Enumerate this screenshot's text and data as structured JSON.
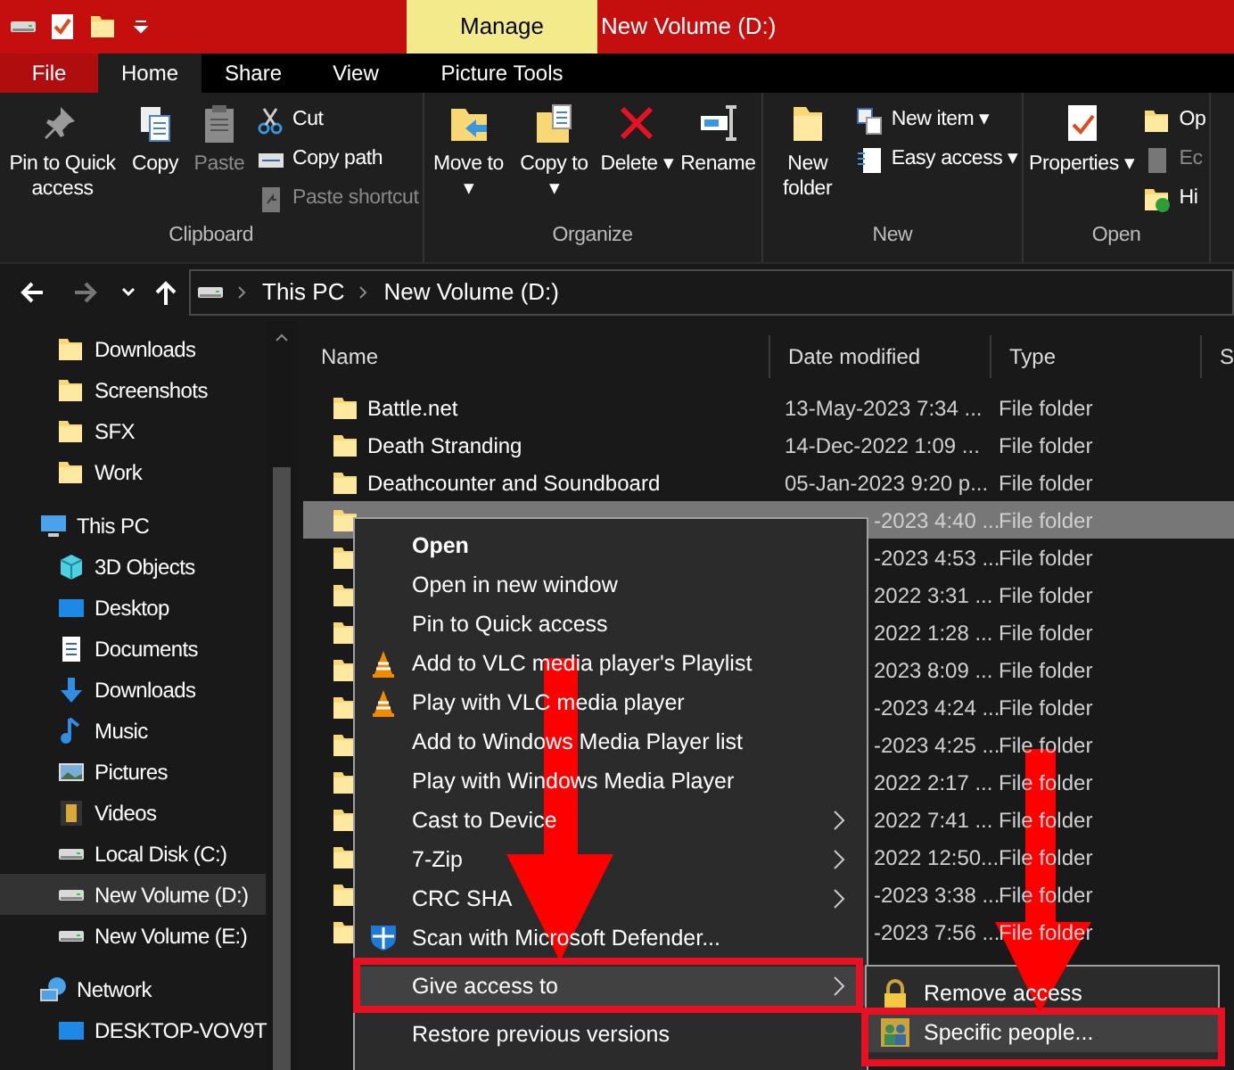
{
  "window": {
    "title": "New Volume (D:)",
    "context_tab": "Manage"
  },
  "tabs": [
    {
      "label": "File",
      "selected": false,
      "kind": "file"
    },
    {
      "label": "Home",
      "selected": true,
      "kind": "tab"
    },
    {
      "label": "Share",
      "selected": false,
      "kind": "tab"
    },
    {
      "label": "View",
      "selected": false,
      "kind": "tab"
    },
    {
      "label": "Picture Tools",
      "selected": false,
      "kind": "tab"
    }
  ],
  "ribbon": {
    "groups": [
      {
        "label": "Clipboard",
        "large": [
          {
            "label": "Pin to Quick access",
            "disabled": false
          },
          {
            "label": "Copy",
            "disabled": false
          },
          {
            "label": "Paste",
            "disabled": true
          }
        ],
        "small": [
          {
            "label": "Cut",
            "disabled": false
          },
          {
            "label": "Copy path",
            "disabled": false
          },
          {
            "label": "Paste shortcut",
            "disabled": true
          }
        ]
      },
      {
        "label": "Organize",
        "large": [
          {
            "label": "Move to ▾",
            "disabled": false
          },
          {
            "label": "Copy to ▾",
            "disabled": false
          },
          {
            "label": "Delete ▾",
            "disabled": false
          },
          {
            "label": "Rename",
            "disabled": false
          }
        ]
      },
      {
        "label": "New",
        "large": [
          {
            "label": "New folder",
            "disabled": false
          }
        ],
        "small": [
          {
            "label": "New item ▾",
            "disabled": false
          },
          {
            "label": "Easy access ▾",
            "disabled": false
          }
        ]
      },
      {
        "label": "Open",
        "large": [
          {
            "label": "Properties ▾",
            "disabled": false
          }
        ],
        "small": [
          {
            "label": "Op",
            "disabled": false
          },
          {
            "label": "Ec",
            "disabled": true
          },
          {
            "label": "Hi",
            "disabled": false
          }
        ]
      }
    ]
  },
  "address": {
    "back_disabled": false,
    "forward_disabled": true,
    "path": [
      "This PC",
      "New Volume (D:)"
    ]
  },
  "sidebar": {
    "items": [
      {
        "label": "Downloads",
        "selected": false
      },
      {
        "label": "Screenshots",
        "selected": false
      },
      {
        "label": "SFX",
        "selected": false
      },
      {
        "label": "Work",
        "selected": false
      },
      {
        "label": "This PC",
        "selected": false,
        "children": [
          {
            "label": "3D Objects",
            "selected": false
          },
          {
            "label": "Desktop",
            "selected": false
          },
          {
            "label": "Documents",
            "selected": false
          },
          {
            "label": "Downloads",
            "selected": false
          },
          {
            "label": "Music",
            "selected": false
          },
          {
            "label": "Pictures",
            "selected": false
          },
          {
            "label": "Videos",
            "selected": false
          },
          {
            "label": "Local Disk (C:)",
            "selected": false
          },
          {
            "label": "New Volume (D:)",
            "selected": true
          },
          {
            "label": "New Volume (E:)",
            "selected": false
          }
        ]
      },
      {
        "label": "Network",
        "selected": false,
        "children": [
          {
            "label": "DESKTOP-VOV9T",
            "selected": false
          }
        ]
      }
    ]
  },
  "table": {
    "columns": [
      "Name",
      "Date modified",
      "Type",
      "S"
    ],
    "rows": [
      {
        "name": "Battle.net",
        "date": "13-May-2023 7:34 ...",
        "type": "File folder",
        "selected": false
      },
      {
        "name": "Death Stranding",
        "date": "14-Dec-2022 1:09 ...",
        "type": "File folder",
        "selected": false
      },
      {
        "name": "Deathcounter and Soundboard",
        "date": "05-Jan-2023 9:20 p...",
        "type": "File folder",
        "selected": false
      },
      {
        "date": "-2023 4:40 ...",
        "type": "File folder",
        "selected": true
      },
      {
        "date": "-2023 4:53 ...",
        "type": "File folder",
        "selected": false
      },
      {
        "date": "2022 3:31 ...",
        "type": "File folder",
        "selected": false
      },
      {
        "date": "2022 1:28 ...",
        "type": "File folder",
        "selected": false
      },
      {
        "date": "2023 8:09 ...",
        "type": "File folder",
        "selected": false
      },
      {
        "date": "-2023 4:24 ...",
        "type": "File folder",
        "selected": false
      },
      {
        "date": "-2023 4:25 ...",
        "type": "File folder",
        "selected": false
      },
      {
        "date": "2022 2:17 ...",
        "type": "File folder",
        "selected": false
      },
      {
        "date": "2022 7:41 ...",
        "type": "File folder",
        "selected": false
      },
      {
        "date": "2022 12:50...",
        "type": "File folder",
        "selected": false
      },
      {
        "date": "-2023 3:38 ...",
        "type": "File folder",
        "selected": false
      },
      {
        "date": "-2023 7:56 ...",
        "type": "File folder",
        "selected": false
      }
    ]
  },
  "context_menu": {
    "items": [
      {
        "label": "Open",
        "bold": true,
        "submenu": false,
        "selected": false
      },
      {
        "label": "Open in new window",
        "bold": false,
        "submenu": false,
        "selected": false
      },
      {
        "label": "Pin to Quick access",
        "bold": false,
        "submenu": false,
        "selected": false
      },
      {
        "label": "Add to VLC media player's Playlist",
        "bold": false,
        "submenu": false,
        "selected": false,
        "kind": "vlc"
      },
      {
        "label": "Play with VLC media player",
        "bold": false,
        "submenu": false,
        "selected": false,
        "kind": "vlc"
      },
      {
        "label": "Add to Windows Media Player list",
        "bold": false,
        "submenu": false,
        "selected": false
      },
      {
        "label": "Play with Windows Media Player",
        "bold": false,
        "submenu": false,
        "selected": false
      },
      {
        "label": "Cast to Device",
        "bold": false,
        "submenu": true,
        "selected": false
      },
      {
        "label": "7-Zip",
        "bold": false,
        "submenu": true,
        "selected": false
      },
      {
        "label": "CRC SHA",
        "bold": false,
        "submenu": true,
        "selected": false
      },
      {
        "label": "Scan with Microsoft Defender...",
        "bold": false,
        "submenu": false,
        "selected": false,
        "kind": "shield"
      },
      {
        "kind": "separator"
      },
      {
        "label": "Give access to",
        "bold": false,
        "submenu": true,
        "selected": true
      },
      {
        "label": "Restore previous versions",
        "bold": false,
        "submenu": false,
        "selected": false
      }
    ]
  },
  "submenu": {
    "items": [
      {
        "label": "Remove access",
        "selected": false,
        "kind": "lock"
      },
      {
        "label": "Specific people...",
        "selected": true,
        "kind": "people"
      }
    ]
  }
}
